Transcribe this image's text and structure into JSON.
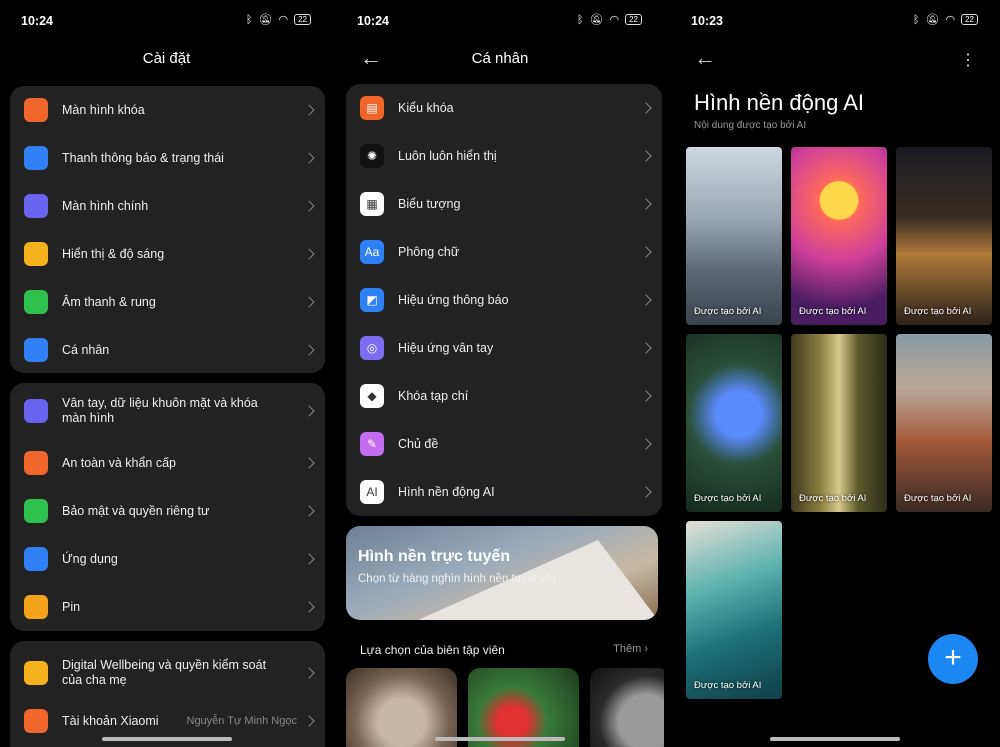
{
  "status": [
    {
      "time": "10:24",
      "battery": "22"
    },
    {
      "time": "10:24",
      "battery": "22"
    },
    {
      "time": "10:23",
      "battery": "22"
    }
  ],
  "settings": {
    "title": "Cài đặt",
    "groups": [
      [
        {
          "label": "Màn hình khóa",
          "color": "#f06529",
          "icon": "lock-icon"
        },
        {
          "label": "Thanh thông báo & trạng thái",
          "color": "#2f7ff5",
          "icon": "notification-icon"
        },
        {
          "label": "Màn hình chính",
          "color": "#6a63f0",
          "icon": "home-icon"
        },
        {
          "label": "Hiển thị & độ sáng",
          "color": "#f5b21c",
          "icon": "sun-icon"
        },
        {
          "label": "Âm thanh & rung",
          "color": "#2fbf4d",
          "icon": "speaker-icon"
        },
        {
          "label": "Cá nhân",
          "color": "#2f7ff5",
          "icon": "brush-icon"
        }
      ],
      [
        {
          "label": "Vân tay, dữ liệu khuôn mặt và khóa màn hình",
          "color": "#6a63f0",
          "icon": "fingerprint-icon"
        },
        {
          "label": "An toàn và khẩn cấp",
          "color": "#f06529",
          "icon": "emergency-icon"
        },
        {
          "label": "Bảo mật và quyền riêng tư",
          "color": "#2fbf4d",
          "icon": "shield-icon"
        },
        {
          "label": "Ứng dụng",
          "color": "#2f7ff5",
          "icon": "apps-icon"
        },
        {
          "label": "Pin",
          "color": "#f5a21c",
          "icon": "battery-icon"
        }
      ],
      [
        {
          "label": "Digital Wellbeing và quyền kiểm soát của cha mẹ",
          "color": "#f5b21c",
          "icon": "wellbeing-icon"
        },
        {
          "label": "Tài khoản Xiaomi",
          "color": "#f06529",
          "icon": "xiaomi-icon",
          "value": "Nguyễn Tự Minh Ngọc"
        }
      ]
    ]
  },
  "personal": {
    "title": "Cá nhân",
    "items": [
      {
        "label": "Kiểu khóa",
        "color": "#f06529",
        "icon": "lock-style-icon",
        "glyph": "▤"
      },
      {
        "label": "Luôn luôn hiển thị",
        "color": "#111111",
        "icon": "aod-icon",
        "glyph": "✺"
      },
      {
        "label": "Biểu tượng",
        "color": "#ffffff",
        "icon": "icons-icon",
        "glyph": "▦"
      },
      {
        "label": "Phông chữ",
        "color": "#2f7ff5",
        "icon": "font-icon",
        "glyph": "Aa"
      },
      {
        "label": "Hiệu ứng thông báo",
        "color": "#2f7ff5",
        "icon": "notification-effect-icon",
        "glyph": "◩"
      },
      {
        "label": "Hiệu ứng vân tay",
        "color": "#7b6cf0",
        "icon": "fingerprint-effect-icon",
        "glyph": "◎"
      },
      {
        "label": "Khóa tạp chí",
        "color": "#ffffff",
        "icon": "magazine-icon",
        "glyph": "◆"
      },
      {
        "label": "Chủ đề",
        "color": "#c46cf0",
        "icon": "theme-icon",
        "glyph": "✎"
      },
      {
        "label": "Hình nền động AI",
        "color": "#ffffff",
        "icon": "ai-wallpaper-icon",
        "glyph": "AI"
      }
    ],
    "banner": {
      "title": "Hình nền trực tuyến",
      "subtitle": "Chọn từ hàng nghìn hình nền tuyệt vời"
    },
    "section": {
      "title": "Lựa chọn của biên tập viên",
      "more": "Thêm"
    }
  },
  "ai_wallpaper": {
    "title": "Hình nền động AI",
    "subtitle": "Nội dung được tạo bởi AI",
    "items": [
      {
        "caption": "Được tạo bởi AI",
        "bg": "linear-gradient(180deg,#cfd8e0 0%,#9aa6b2 40%,#5d6874 70%,#3a434c 100%)"
      },
      {
        "caption": "Được tạo bởi AI",
        "bg": "radial-gradient(circle at 50% 30%,#ffd74a 0 14%,#ff6a5a 15%,#d0409a 45%,#4a1d60 80%)"
      },
      {
        "caption": "Được tạo bởi AI",
        "bg": "linear-gradient(180deg,#1a1a22 0%,#3a2e24 40%,#b07a3a 60%,#2a2219 100%)"
      },
      {
        "caption": "Được tạo bởi AI",
        "bg": "radial-gradient(circle at 55% 45%,#5a8cff 0 20%,#2a4f3a 45%,#132a1c 100%)"
      },
      {
        "caption": "Được tạo bởi AI",
        "bg": "linear-gradient(90deg,#3c3a1f 0%,#8a7d3e 30%,#d9c98a 50%,#5b5a2c 70%,#2b2c18 100%)"
      },
      {
        "caption": "Được tạo bởi AI",
        "bg": "linear-gradient(180deg,#8b9aa3 0%,#b9a898 30%,#a45a3c 60%,#3a2a24 100%)"
      },
      {
        "caption": "Được tạo bởi AI",
        "bg": "linear-gradient(160deg,#e6e0d6 0%,#5fb3b0 35%,#1d6f78 65%,#0f3f48 100%)"
      }
    ]
  }
}
